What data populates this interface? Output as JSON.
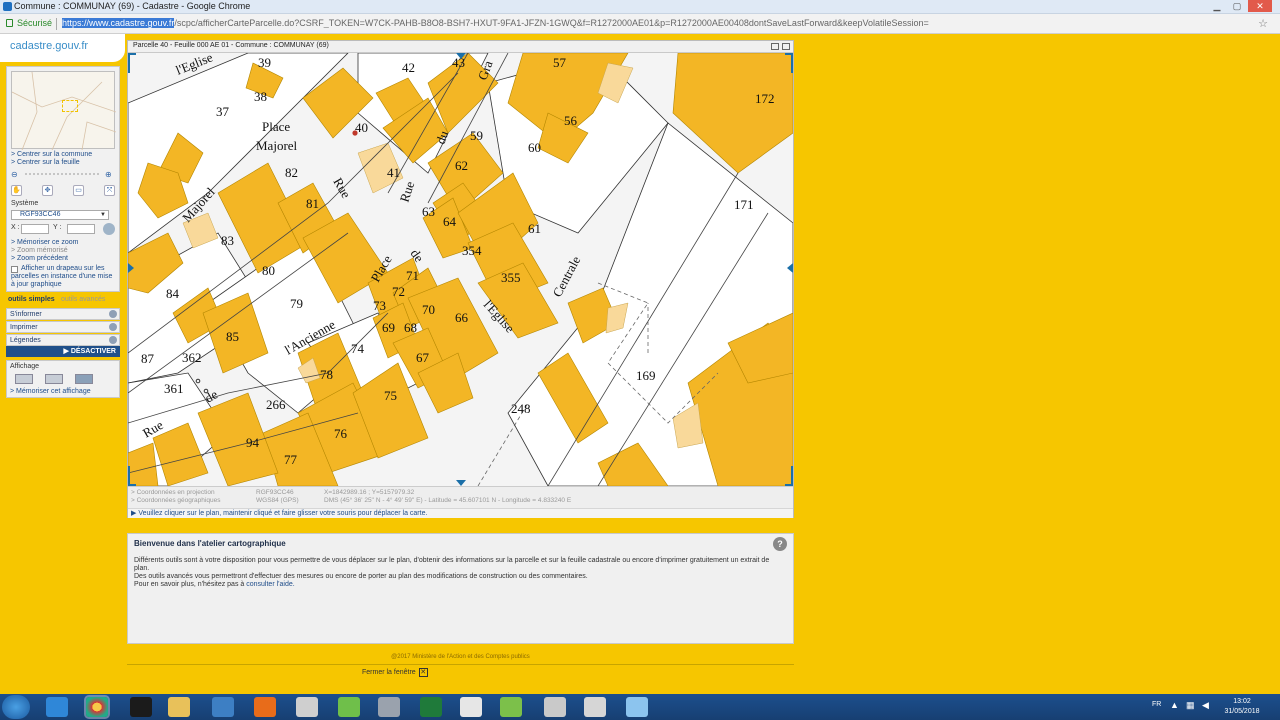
{
  "browser": {
    "window_title": "Commune : COMMUNAY (69) - Cadastre - Google Chrome",
    "secure_label": "Sécurisé",
    "url_selected": "https://www.cadastre.gouv.fr",
    "url_rest": "/scpc/afficherCarteParcelle.do?CSRF_TOKEN=W7CK-PAHB-B8O8-BSH7-HXUT-9FA1-JFZN-1GWQ&f=R1272000AE01&p=R1272000AE00408dontSaveLastForward&keepVolatileSession="
  },
  "logo": "cadastre.gouv.fr",
  "left_panel": {
    "center_commune": "> Centrer sur la commune",
    "center_sheet": "> Centrer sur la feuille",
    "system_label": "Système",
    "system_value": "RGF93CC46",
    "x_label": "X :",
    "y_label": "Y :",
    "memorize_zoom": "> Mémoriser ce zoom",
    "memorized_zoom": "> Zoom mémorisé",
    "previous_zoom": "> Zoom précédent",
    "flag_text_1": "Afficher un drapeau sur les",
    "flag_text_2": "parcelles en instance d'une mise",
    "flag_text_3": "à jour graphique"
  },
  "tools": {
    "tab_simple": "outils simples",
    "tab_advanced": "outils avancés",
    "inform": "S'informer",
    "print": "Imprimer",
    "legends": "Légendes",
    "deactivate": "▶ DÉSACTIVER"
  },
  "display": {
    "title": "Affichage",
    "memorize": "> Mémoriser cet affichage"
  },
  "map": {
    "header": "Parcelle 40 - Feuille 000 AE 01 - Commune : COMMUNAY (69)",
    "labels": {
      "streets": [
        "l'Eglise",
        "Place",
        "Majorel",
        "Rue",
        "du",
        "Majorel",
        "Rue",
        "de",
        "Place",
        "l'Ancienne",
        "Rue",
        "de",
        "l'Eglise",
        "Centrale",
        "Gra"
      ],
      "parcels": [
        "39",
        "38",
        "37",
        "42",
        "43",
        "57",
        "172",
        "40",
        "41",
        "56",
        "59",
        "60",
        "82",
        "62",
        "81",
        "63",
        "64",
        "61",
        "171",
        "83",
        "354",
        "80",
        "71",
        "355",
        "84",
        "72",
        "73",
        "79",
        "70",
        "66",
        "85",
        "69",
        "68",
        "87",
        "362",
        "74",
        "67",
        "169",
        "78",
        "361",
        "75",
        "266",
        "248",
        "76",
        "94",
        "77"
      ]
    },
    "coord_proj_label": "> Coordonnées en projection",
    "coord_proj_system": "RGF93CC46",
    "coord_proj_value": "X=1842989.16 ; Y=5157979.32",
    "coord_geo_label": "> Coordonnées géographiques",
    "coord_geo_system": "WGS84 (GPS)",
    "coord_geo_value": "DMS (45° 36' 25'' N - 4° 49' 59'' E) - Latitude = 45.607101 N - Longitude = 4.833240 E",
    "status": "▶ Veuillez cliquer sur le plan, maintenir cliqué et faire glisser votre souris pour déplacer la carte."
  },
  "welcome": {
    "title": "Bienvenue dans l'atelier cartographique",
    "p1": "Différents outils sont à votre disposition pour vous permettre de vous déplacer sur le plan, d'obtenir des informations sur la parcelle et sur la feuille cadastrale ou encore d'imprimer gratuitement un extrait de plan.",
    "p2": "Des outils avancés vous permettront d'effectuer des mesures ou encore de porter au plan des modifications de construction ou des commentaires.",
    "p3_prefix": "Pour en savoir plus, n'hésitez pas à",
    "p3_link": "consulter l'aide."
  },
  "footer": {
    "copyright": "@2017 Ministère de l'Action et des Comptes publics",
    "close_window": "Fermer la fenêtre"
  },
  "taskbar": {
    "lang": "FR",
    "time": "13:02",
    "date": "31/05/2018"
  }
}
